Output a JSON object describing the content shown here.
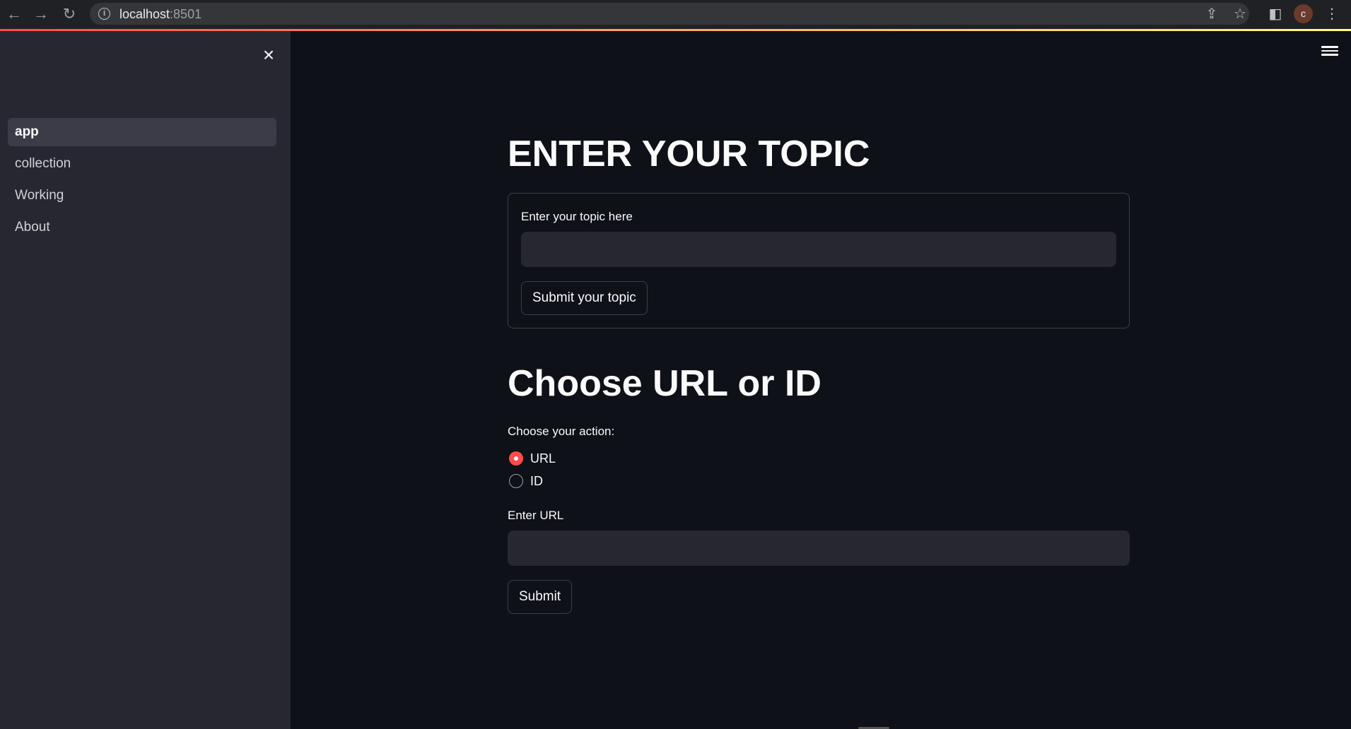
{
  "browser": {
    "url_host": "localhost",
    "url_port": ":8501",
    "avatar_letter": "c"
  },
  "sidebar": {
    "items": [
      {
        "label": "app",
        "active": true
      },
      {
        "label": "collection",
        "active": false
      },
      {
        "label": "Working",
        "active": false
      },
      {
        "label": "About",
        "active": false
      }
    ]
  },
  "main": {
    "topic_heading": "ENTER YOUR TOPIC",
    "topic_form": {
      "label": "Enter your topic here",
      "value": "",
      "submit_label": "Submit your topic"
    },
    "choose_heading": "Choose URL or ID",
    "action": {
      "label": "Choose your action:",
      "options": [
        "URL",
        "ID"
      ],
      "selected": "URL"
    },
    "url_form": {
      "label": "Enter URL",
      "value": "",
      "submit_label": "Submit"
    }
  },
  "colors": {
    "accent": "#ff4b4b",
    "background": "#0e1117",
    "sidebar": "#262730",
    "text": "#fafafa"
  }
}
